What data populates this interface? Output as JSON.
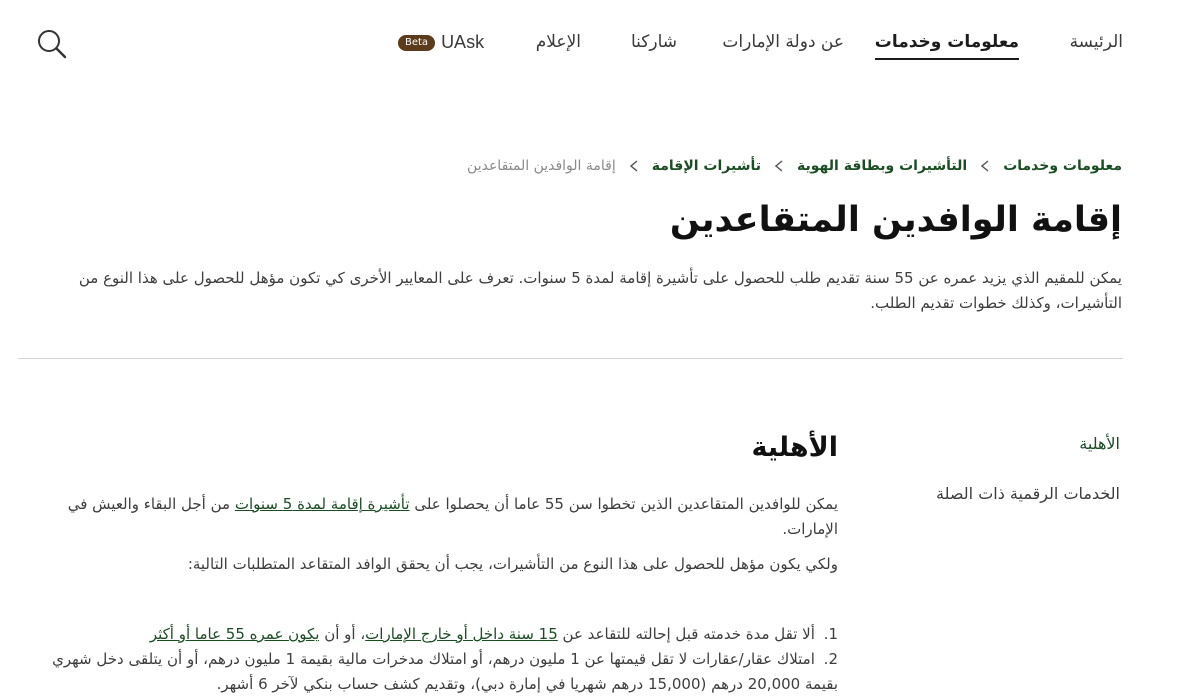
{
  "nav": {
    "home": "الرئيسة",
    "info_services": "معلومات وخدمات",
    "about_uae": "عن دولة الإمارات",
    "participate": "شاركنا",
    "media": "الإعلام",
    "uask": "UAsk",
    "beta": "Beta",
    "search_icon": "search-icon"
  },
  "breadcrumb": {
    "items": [
      "معلومات وخدمات",
      "التأشيرات وبطاقة الهوية",
      "تأشيرات الإقامة"
    ],
    "current": "إقامة الوافدين المتقاعدين"
  },
  "page": {
    "title": "إقامة الوافدين المتقاعدين",
    "intro": "يمكن للمقيم الذي يزيد عمره عن 55 سنة تقديم طلب للحصول على تأشيرة إقامة لمدة 5 سنوات. تعرف على المعايير الأخرى كي تكون مؤهل للحصول على هذا النوع من التأشيرات، وكذلك خطوات تقديم الطلب."
  },
  "side_menu": {
    "eligibility": "الأهلية",
    "digital_services": "الخدمات الرقمية ذات الصلة"
  },
  "section": {
    "title": "الأهلية",
    "para1_before": "يمكن للوافدين المتقاعدين الذين تخطوا سن 55 عاما أن يحصلوا على ",
    "para1_link": "تأشيرة إقامة لمدة 5 سنوات",
    "para1_after": " من أجل البقاء والعيش في الإمارات.",
    "para2": "ولكي يكون مؤهل للحصول على هذا النوع من التأشيرات، يجب أن يحقق الوافد المتقاعد المتطلبات التالية:",
    "req1_num": "1.",
    "req1_before": "ألا تقل مدة خدمته قبل إحالته للتقاعد عن ",
    "req1_link1": "15 سنة داخل أو خارج الإمارات",
    "req1_mid": "، أو أن ",
    "req1_link2": "يكون عمره 55 عاما أو أكثر",
    "req2_num": "2.",
    "req2_text": "امتلاك عقار/عقارات لا تقل قيمتها عن 1 مليون درهم، أو امتلاك مدخرات مالية بقيمة 1 مليون درهم، أو أن يتلقى دخل شهري بقيمة 20,000 درهم (15,000 درهم شهريا في إمارة دبي)، وتقديم كشف حساب بنكي لآخر 6 أشهر."
  },
  "colors": {
    "link_green": "#1b4d23",
    "beta_brown": "#5b3b1b",
    "text_dark": "#111111",
    "text_body": "#3d3d3d",
    "divider": "#d4d4d4"
  }
}
